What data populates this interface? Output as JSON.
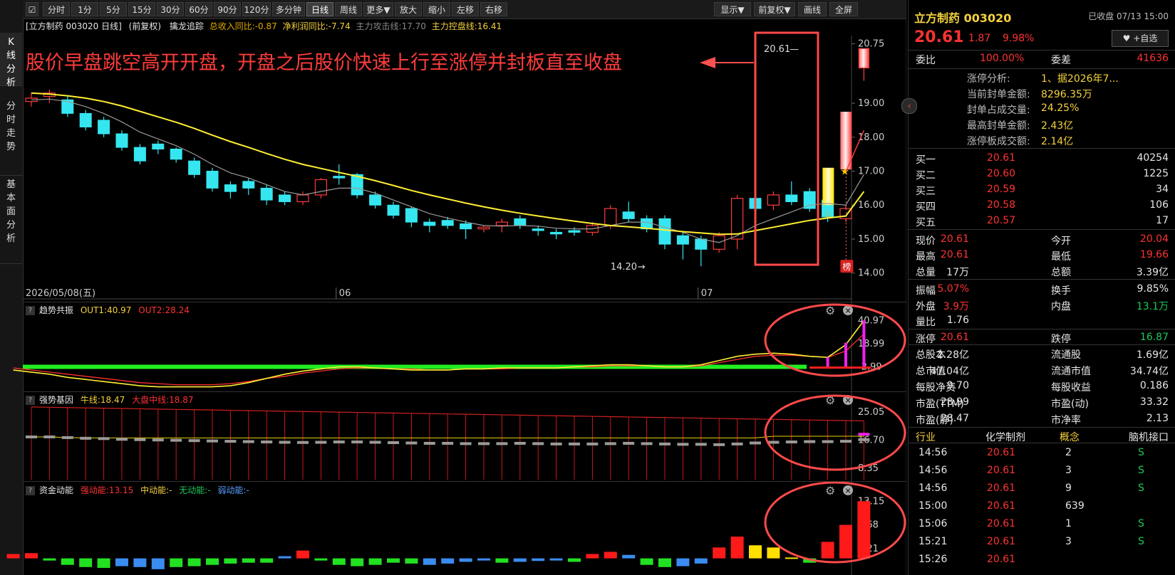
{
  "left_tabs": [
    {
      "label": "K线分析",
      "chars": [
        "K",
        "线",
        "分",
        "析"
      ]
    },
    {
      "label": "分时走势",
      "chars": [
        "分",
        "时",
        "走",
        "势"
      ]
    },
    {
      "label": "基本面分析",
      "chars": [
        "基",
        "本",
        "面",
        "分",
        "析"
      ]
    }
  ],
  "toolbar": {
    "left": [
      "分时",
      "1分",
      "5分",
      "15分",
      "30分",
      "60分",
      "90分",
      "120分",
      "多分钟",
      "日线",
      "周线",
      "更多▼",
      "放大",
      "缩小",
      "左移",
      "右移"
    ],
    "active": "日线",
    "right": [
      "显示▼",
      "前复权▼",
      "画线",
      "全屏"
    ]
  },
  "info_row": {
    "stock": "[立方制药 003020 日线]",
    "adjust": "(前复权)",
    "indicator": "擒龙追踪",
    "f1": "总收入同比:-0.87",
    "f2": "净利润同比:-7.74",
    "f3": "主力攻击线:17.70",
    "f4": "主力控盘线:16.41"
  },
  "annotation": "股价早盘跳空高开开盘，开盘之后股价快速上行至涨停并封板直至收盘",
  "main_chart": {
    "y_ticks": [
      "20.75",
      "19.00",
      "18.00",
      "17.00",
      "16.00",
      "15.00",
      "14.00"
    ],
    "y_values": [
      20.75,
      19,
      18,
      17,
      16,
      15,
      14
    ],
    "date_label": "2026/05/08(五)",
    "month_labels": [
      "06",
      "07"
    ],
    "low_label": "14.20",
    "high_label": "20.61",
    "badge": "榜"
  },
  "panel1": {
    "name": "趋势共振",
    "out1": "OUT1:40.97",
    "out2": "OUT2:28.24",
    "ticks": [
      "40.97",
      "18.99",
      "-2.99"
    ]
  },
  "panel2": {
    "name": "强势基因",
    "l1": "牛线:18.47",
    "l2": "大盘中线:18.87",
    "ticks": [
      "25.05",
      "16.70",
      "8.35"
    ]
  },
  "panel3": {
    "name": "资金动能",
    "l1": "强动能:13.15",
    "l2": "中动能:-",
    "l3": "无动能:-",
    "l4": "弱动能:-",
    "ticks": [
      "13.15",
      "7.68",
      "2.21"
    ]
  },
  "chart_data": {
    "type": "candlestick",
    "title": "立方制药 003020 日线",
    "open": [
      19.05,
      19.2,
      19.1,
      18.7,
      18.5,
      18.1,
      17.7,
      17.8,
      17.65,
      17.3,
      17.0,
      16.6,
      16.7,
      16.5,
      16.3,
      16.1,
      16.3,
      16.85,
      16.9,
      16.3,
      16.0,
      15.9,
      15.5,
      15.55,
      15.45,
      15.3,
      15.4,
      15.6,
      15.3,
      15.2,
      15.25,
      15.2,
      15.4,
      15.8,
      15.6,
      15.6,
      15.1,
      15.0,
      14.7,
      15.0,
      16.2,
      16.0,
      16.3,
      16.4,
      16.15,
      15.6,
      20.04
    ],
    "close": [
      19.15,
      19.3,
      18.7,
      18.3,
      18.1,
      17.7,
      17.3,
      17.65,
      17.35,
      16.9,
      16.5,
      16.4,
      16.5,
      16.15,
      16.1,
      16.3,
      16.75,
      16.8,
      16.3,
      16.0,
      15.7,
      15.5,
      15.4,
      15.4,
      15.3,
      15.35,
      15.5,
      15.4,
      15.25,
      15.15,
      15.2,
      15.4,
      15.9,
      15.6,
      15.3,
      14.85,
      14.85,
      14.7,
      15.1,
      16.2,
      15.9,
      16.3,
      16.1,
      15.9,
      15.65,
      15.9,
      20.61
    ],
    "high": [
      19.3,
      19.4,
      19.2,
      18.8,
      18.6,
      18.2,
      17.8,
      17.9,
      17.7,
      17.4,
      17.1,
      16.7,
      16.8,
      16.6,
      16.4,
      16.4,
      16.8,
      17.2,
      16.95,
      16.4,
      16.1,
      15.95,
      15.6,
      15.65,
      15.55,
      15.4,
      15.6,
      15.7,
      15.4,
      15.3,
      15.35,
      15.5,
      16.0,
      16.1,
      15.7,
      15.7,
      15.2,
      15.1,
      15.2,
      16.3,
      16.8,
      16.4,
      16.7,
      16.5,
      16.2,
      16.0,
      20.61
    ],
    "low": [
      18.9,
      19.0,
      18.6,
      18.2,
      18.0,
      17.6,
      17.2,
      17.5,
      17.25,
      16.8,
      16.4,
      16.2,
      16.3,
      16.0,
      16.0,
      16.0,
      16.2,
      16.6,
      16.2,
      15.9,
      15.6,
      15.35,
      15.2,
      15.3,
      15.0,
      15.2,
      15.2,
      15.3,
      15.1,
      15.0,
      15.1,
      15.1,
      15.3,
      15.5,
      15.2,
      14.7,
      14.4,
      14.2,
      14.6,
      14.7,
      15.8,
      15.85,
      16.0,
      15.8,
      15.5,
      15.5,
      19.66
    ],
    "ma_yellow": [
      19.3,
      19.27,
      19.22,
      19.15,
      19.05,
      18.92,
      18.76,
      18.6,
      18.44,
      18.26,
      18.06,
      17.87,
      17.7,
      17.52,
      17.35,
      17.2,
      17.08,
      16.96,
      16.85,
      16.72,
      16.58,
      16.43,
      16.3,
      16.18,
      16.06,
      15.95,
      15.85,
      15.76,
      15.68,
      15.6,
      15.53,
      15.46,
      15.4,
      15.36,
      15.32,
      15.27,
      15.22,
      15.18,
      15.14,
      15.15,
      15.25,
      15.35,
      15.45,
      15.55,
      15.62,
      15.68,
      16.4
    ],
    "ma_gray": [
      19.1,
      19.12,
      19.05,
      18.9,
      18.7,
      18.45,
      18.15,
      17.95,
      17.75,
      17.5,
      17.2,
      16.95,
      16.8,
      16.6,
      16.4,
      16.3,
      16.4,
      16.5,
      16.5,
      16.35,
      16.15,
      15.95,
      15.75,
      15.62,
      15.5,
      15.4,
      15.38,
      15.4,
      15.38,
      15.32,
      15.3,
      15.3,
      15.4,
      15.5,
      15.5,
      15.35,
      15.2,
      15.0,
      14.9,
      15.1,
      15.4,
      15.6,
      15.8,
      16.0,
      16.05,
      16.0,
      16.9
    ],
    "last_close": 20.61,
    "low_marker": 14.2,
    "trend_out1": [
      -6,
      -8,
      -10,
      -13,
      -15,
      -17,
      -19,
      -21,
      -22,
      -22,
      -22,
      -22,
      -21,
      -18,
      -14,
      -10,
      -7,
      -5,
      -3,
      -3,
      -4,
      -5,
      -6,
      -6,
      -6,
      -5,
      -5,
      -4,
      -4,
      -4,
      -4,
      -3,
      -2,
      -1,
      -1,
      -2,
      -3,
      -3,
      -1,
      3,
      7,
      9,
      10,
      9,
      7,
      6,
      18,
      40.97
    ],
    "trend_out2": [
      -4,
      -6,
      -8,
      -10,
      -12,
      -14,
      -16,
      -18,
      -19,
      -20,
      -20,
      -20,
      -19,
      -17,
      -14,
      -12,
      -9,
      -7,
      -5,
      -4,
      -4,
      -5,
      -5,
      -6,
      -6,
      -5,
      -5,
      -5,
      -4,
      -4,
      -4,
      -3,
      -3,
      -2,
      -2,
      -2,
      -3,
      -3,
      -2,
      1,
      4,
      7,
      8,
      8,
      7,
      6,
      12,
      28.24
    ],
    "trend_bars": [
      6,
      20,
      41
    ],
    "gene_gray": [
      17.7,
      17.7,
      17.5,
      17.3,
      17.2,
      17.0,
      16.9,
      16.8,
      16.7,
      16.6,
      16.5,
      16.4,
      16.3,
      16.2,
      16.1,
      16.05,
      16.1,
      16.2,
      16.2,
      16.1,
      16.0,
      15.9,
      15.8,
      15.8,
      15.7,
      15.7,
      15.7,
      15.8,
      15.7,
      15.6,
      15.6,
      15.6,
      15.7,
      15.8,
      15.7,
      15.6,
      15.5,
      15.5,
      15.4,
      15.6,
      15.9,
      16.1,
      16.2,
      16.3,
      16.3,
      16.4,
      16.9
    ],
    "capital": [
      1.0,
      1.2,
      -0.5,
      -1.5,
      -2.0,
      -2.2,
      -1.8,
      -2.0,
      -2.5,
      -2.0,
      -1.8,
      -1.5,
      -1.2,
      -1.0,
      -1.0,
      0.5,
      1.8,
      -0.5,
      -1.5,
      -1.8,
      -1.5,
      -1.0,
      -1.2,
      -1.5,
      -1.2,
      -0.8,
      -0.5,
      -1.0,
      -0.8,
      -0.6,
      -0.5,
      -0.8,
      1.0,
      1.5,
      0.8,
      -1.5,
      -2.0,
      -1.8,
      -1.2,
      2.5,
      5.0,
      3.0,
      2.5,
      0.2,
      -1.0,
      3.8,
      7.7,
      13.15
    ],
    "capital_colors": [
      "#ff1a1a",
      "#ff1a1a",
      "#22e022",
      "#22e022",
      "#22e022",
      "#22e022",
      "#3a8cf0",
      "#3a8cf0",
      "#3a8cf0",
      "#22e022",
      "#22e022",
      "#22e022",
      "#22e022",
      "#22e022",
      "#22e022",
      "#3a8cf0",
      "#ff1a1a",
      "#22e022",
      "#22e022",
      "#22e022",
      "#22e022",
      "#22e022",
      "#22e022",
      "#3a8cf0",
      "#3a8cf0",
      "#3a8cf0",
      "#3a8cf0",
      "#22e022",
      "#3a8cf0",
      "#3a8cf0",
      "#3a8cf0",
      "#22e022",
      "#ff1a1a",
      "#ff1a1a",
      "#3a8cf0",
      "#22e022",
      "#22e022",
      "#3a8cf0",
      "#3a8cf0",
      "#ff1a1a",
      "#ff1a1a",
      "#ffe000",
      "#ffe000",
      "#ffe000",
      "#22e022",
      "#ff1a1a",
      "#ff1a1a",
      "#ff1a1a"
    ]
  },
  "quote": {
    "name_code": "立方制药 003020",
    "status": "已收盘 07/13 15:00",
    "price": "20.61",
    "change": "1.87",
    "pct": "9.98%",
    "watch": "+自选",
    "weibi_label": "委比",
    "weibi": "100.00%",
    "weicha_label": "委差",
    "weicha": "41636",
    "limit_rows": [
      {
        "k": "涨停分析:",
        "v": "1、据2026年7..."
      },
      {
        "k": "当前封单金额:",
        "v": "8296.35万"
      },
      {
        "k": "封单占成交量:",
        "v": "24.25%"
      },
      {
        "k": "最高封单金额:",
        "v": "2.43亿"
      },
      {
        "k": "涨停板成交额:",
        "v": "2.14亿"
      }
    ],
    "bids": [
      {
        "k": "买一",
        "p": "20.61",
        "v": "40254"
      },
      {
        "k": "买二",
        "p": "20.60",
        "v": "1225"
      },
      {
        "k": "买三",
        "p": "20.59",
        "v": "34"
      },
      {
        "k": "买四",
        "p": "20.58",
        "v": "106"
      },
      {
        "k": "买五",
        "p": "20.57",
        "v": "17"
      }
    ],
    "stats1": [
      {
        "k1": "现价",
        "v1": "20.61",
        "k2": "今开",
        "v2": "20.04"
      },
      {
        "k1": "最高",
        "v1": "20.61",
        "k2": "最低",
        "v2": "19.66"
      },
      {
        "k1": "总量",
        "v1": "17万",
        "k2": "总额",
        "v2": "3.39亿"
      }
    ],
    "stats2": [
      {
        "k1": "振幅",
        "v1": "5.07%",
        "k2": "换手",
        "v2": "9.85%"
      },
      {
        "k1": "外盘",
        "v1": "3.9万",
        "k2": "内盘",
        "v2": "13.1万"
      },
      {
        "k1": "量比",
        "v1": "1.76",
        "k2": "",
        "v2": ""
      }
    ],
    "limits": {
      "k1": "涨停",
      "v1": "20.61",
      "k2": "跌停",
      "v2": "16.87"
    },
    "fund": [
      {
        "k1": "总股本",
        "v1": "2.28亿",
        "k2": "流通股",
        "v2": "1.69亿"
      },
      {
        "k1": "总市值",
        "v1": "47.04亿",
        "k2": "流通市值",
        "v2": "34.74亿"
      },
      {
        "k1": "每股净资",
        "v1": "9.70",
        "k2": "每股收益",
        "v2": "0.186"
      },
      {
        "k1": "市盈(TTM)",
        "v1": "28.99",
        "k2": "市盈(动)",
        "v2": "33.32"
      },
      {
        "k1": "市盈(静)",
        "v1": "28.47",
        "k2": "市净率",
        "v2": "2.13"
      }
    ],
    "industry": {
      "k1": "行业",
      "v1": "化学制剂",
      "k2": "概念",
      "v2": "脑机接口"
    },
    "ticks": [
      {
        "t": "14:56",
        "p": "20.61",
        "v": "2",
        "s": "S"
      },
      {
        "t": "14:56",
        "p": "20.61",
        "v": "3",
        "s": "S"
      },
      {
        "t": "14:56",
        "p": "20.61",
        "v": "9",
        "s": "S"
      },
      {
        "t": "15:00",
        "p": "20.61",
        "v": "639",
        "s": ""
      },
      {
        "t": "15:06",
        "p": "20.61",
        "v": "1",
        "s": "S"
      },
      {
        "t": "15:21",
        "p": "20.61",
        "v": "3",
        "s": "S"
      },
      {
        "t": "15:26",
        "p": "20.61",
        "v": "",
        "s": ""
      }
    ]
  }
}
